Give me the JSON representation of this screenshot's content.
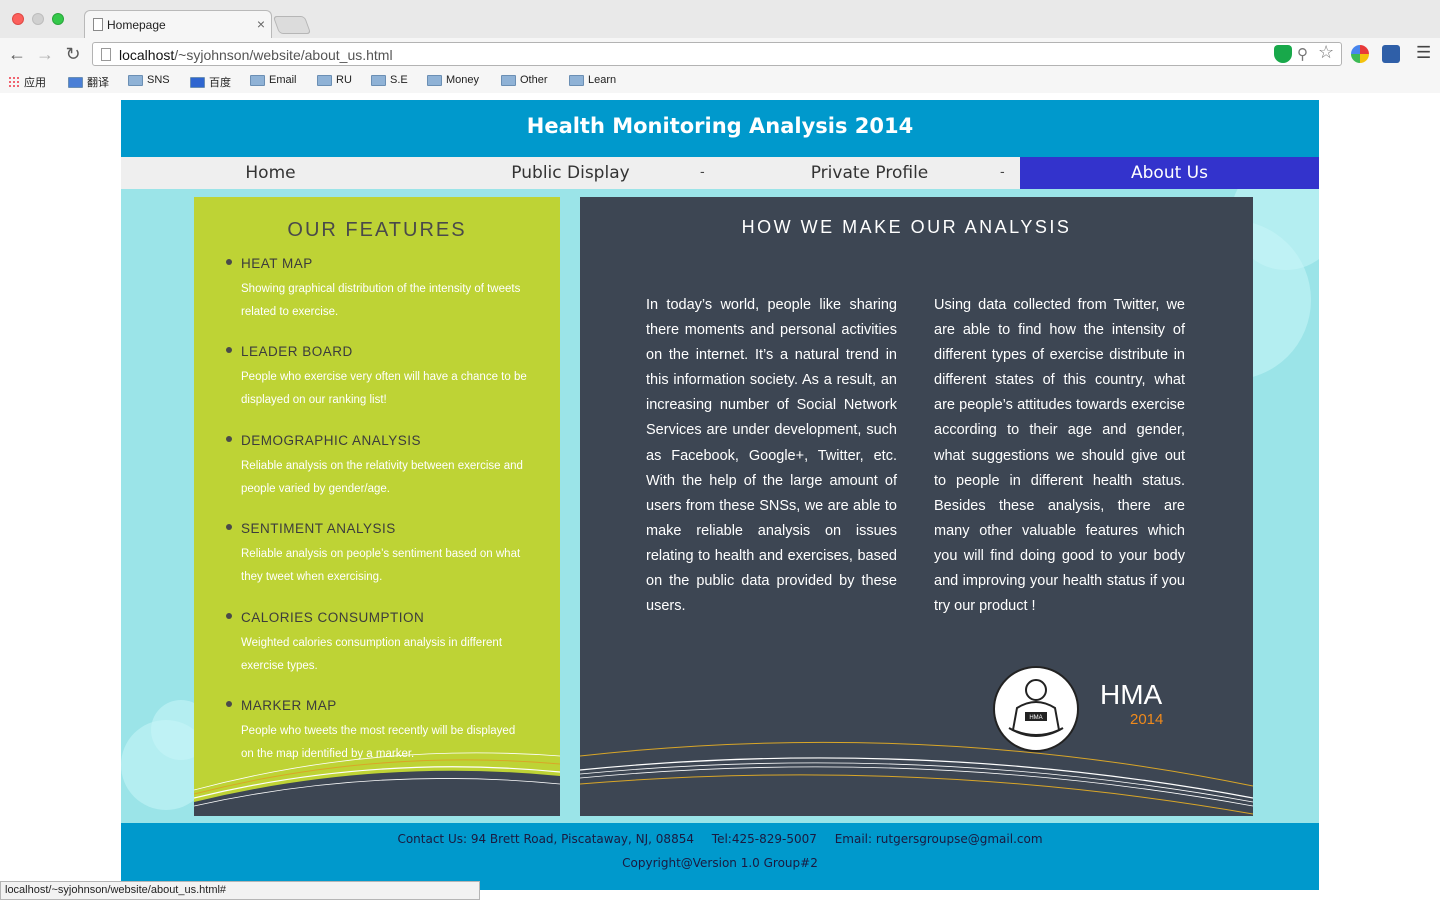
{
  "browser": {
    "tab_title": "Homepage",
    "tab_close": "×",
    "url_host": "localhost",
    "url_path": "/~syjohnson/website/about_us.html",
    "bookmarks": [
      {
        "label": "应用",
        "icon": "apps-grid-icon"
      },
      {
        "label": "翻译",
        "icon": "translate-icon"
      },
      {
        "label": "SNS",
        "icon": "folder-icon"
      },
      {
        "label": "百度",
        "icon": "baidu-icon"
      },
      {
        "label": "Email",
        "icon": "folder-icon"
      },
      {
        "label": "RU",
        "icon": "folder-icon"
      },
      {
        "label": "S.E",
        "icon": "folder-icon"
      },
      {
        "label": "Money",
        "icon": "folder-icon"
      },
      {
        "label": "Other",
        "icon": "folder-icon"
      },
      {
        "label": "Learn",
        "icon": "folder-icon"
      }
    ],
    "status_url": "localhost/~syjohnson/website/about_us.html#"
  },
  "site": {
    "title": "Health Monitoring Analysis 2014",
    "nav": [
      {
        "label": "Home",
        "active": false
      },
      {
        "label": "Public Display",
        "active": false
      },
      {
        "label": "Private Profile",
        "active": false
      },
      {
        "label": "About Us",
        "active": true
      }
    ],
    "nav_separator": "-",
    "colors": {
      "header": "#0099cc",
      "nav_active": "#3333cc",
      "features_bg": "#bed335",
      "analysis_bg": "#3d4653",
      "page_bg": "#9be4e8",
      "logo_year": "#f08a1c"
    }
  },
  "features": {
    "title": "OUR FEATURES",
    "items": [
      {
        "name": "HEAT MAP",
        "desc": "Showing graphical distribution of the intensity of tweets related to exercise."
      },
      {
        "name": "LEADER BOARD",
        "desc": "People who exercise very often will have a chance to be displayed on our ranking list!"
      },
      {
        "name": "DEMOGRAPHIC ANALYSIS",
        "desc": "Reliable analysis on the relativity between exercise and people varied by gender/age."
      },
      {
        "name": "SENTIMENT ANALYSIS",
        "desc": "Reliable analysis on people’s sentiment based on what they tweet when exercising."
      },
      {
        "name": "CALORIES CONSUMPTION",
        "desc": "Weighted calories consumption analysis in different exercise types."
      },
      {
        "name": "MARKER MAP",
        "desc": "People who tweets the most recently will be displayed on the map identified by a marker."
      }
    ]
  },
  "analysis": {
    "title": "HOW WE MAKE OUR ANALYSIS",
    "left_text": "In today’s world, people like sharing there moments and personal activities on the internet. It’s a natural trend in this information society. As a result, an increasing number of Social Network Services are under development, such as Facebook, Google+, Twitter, etc. With the help of the large amount of users from these SNSs, we are able to make reliable analysis on issues relating to health and exercises, based on the public data provided by these users.",
    "right_text": "Using data collected from Twitter, we are able to find how the intensity of different types of exercise distribute in different states of this country, what are people’s attitudes towards exercise according to their age and gender, what suggestions we should give out to people in different health status. Besides these analysis, there are many other valuable features which you will find doing good to your body and improving your health status if you try our product !",
    "logo_name": "HMA",
    "logo_year": "2014",
    "logo_badge": "HMA"
  },
  "footer": {
    "contact": "Contact Us: 94 Brett Road, Piscataway, NJ, 08854",
    "tel": "Tel:425-829-5007",
    "email": "Email: rutgersgroupse@gmail.com",
    "copyright": "Copyright@Version 1.0 Group#2"
  }
}
